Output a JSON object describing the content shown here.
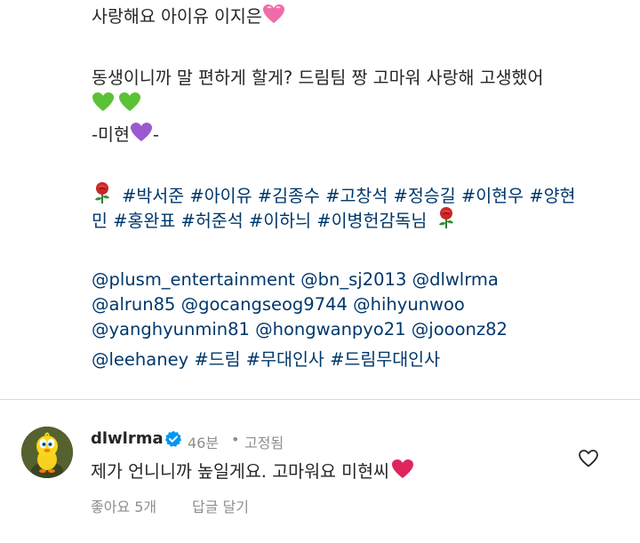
{
  "caption": {
    "line1": "사랑해요 아이유 이지은",
    "line2": "동생이니까 말 편하게 할게? 드림팀 짱 고마워 사랑해 고생했어",
    "line4_prefix": "-미현",
    "line4_suffix": "-",
    "hashtags_row1": [
      "#박서준",
      "#아이유",
      "#김종수",
      "#고창석",
      "#정승길",
      "#이현우",
      "#양현"
    ],
    "hashtags_row2": [
      "민",
      "#홍완표",
      "#허준석",
      "#이하늬",
      "#이병헌감독님"
    ],
    "mentions_row1": [
      "@plusm_entertainment",
      "@bn_sj2013",
      "@dlwlrma"
    ],
    "mentions_row2": [
      "@alrun85",
      "@gocangseog9744",
      "@hihyunwoo"
    ],
    "mentions_row3": [
      "@yanghyunmin81",
      "@hongwanpyo21",
      "@jooonz82"
    ],
    "mentions_row4": [
      "@leehaney",
      "#드림",
      "#무대인사",
      "#드림무대인사"
    ],
    "emoji_icons": [
      "pink-heart-icon",
      "green-heart-icon",
      "purple-heart-icon",
      "rose-icon"
    ]
  },
  "comment": {
    "username": "dlwlrma",
    "time": "46분",
    "separator": "•",
    "pinned": "고정됨",
    "text": "제가 언니니까 높일게요. 고마워요 미현씨",
    "likes": "좋아요 5개",
    "reply": "답글 달기"
  },
  "colors": {
    "link": "#00376b",
    "text": "#262626",
    "secondary": "#8e8e8e",
    "verified": "#0095f6",
    "red_heart": "#e0245e",
    "green_heart": "#5bc236",
    "purple_heart": "#9b59d0",
    "pink_heart": "#f06ca8"
  }
}
